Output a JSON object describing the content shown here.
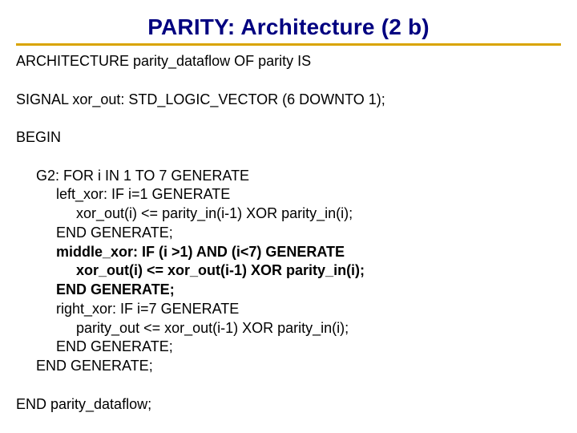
{
  "slide": {
    "title": "PARITY: Architecture (2 b)",
    "line_arch": "ARCHITECTURE parity_dataflow OF parity IS",
    "line_sig": "SIGNAL xor_out: STD_LOGIC_VECTOR (6 DOWNTO 1);",
    "line_begin": "BEGIN",
    "g2": "     G2: FOR i IN 1 TO 7 GENERATE",
    "left1": "          left_xor: IF i=1 GENERATE",
    "left2": "               xor_out(i) <= parity_in(i-1) XOR parity_in(i);",
    "left3": "          END GENERATE;",
    "mid1": "          middle_xor: IF (i >1) AND (i<7) GENERATE",
    "mid2": "               xor_out(i) <= xor_out(i-1) XOR parity_in(i);",
    "mid3": "          END GENERATE;",
    "right1": "          right_xor: IF i=7 GENERATE",
    "right2": "               parity_out <= xor_out(i-1) XOR parity_in(i);",
    "right3": "          END GENERATE;",
    "endg2": "     END GENERATE;",
    "end_arch": "END parity_dataflow;"
  }
}
